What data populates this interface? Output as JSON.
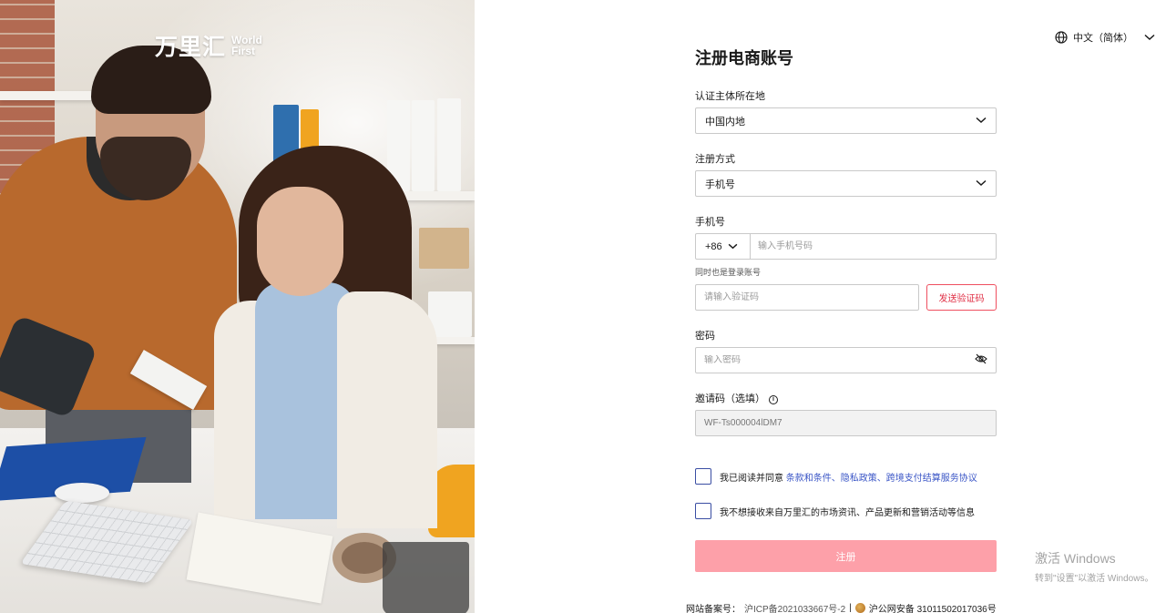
{
  "brand": {
    "name_cn": "万里汇",
    "name_en_line1": "World",
    "name_en_line2": "First"
  },
  "language": {
    "label": "中文（简体）",
    "icon": "globe-icon"
  },
  "form": {
    "title": "注册电商账号",
    "region": {
      "label": "认证主体所在地",
      "value": "中国内地"
    },
    "method": {
      "label": "注册方式",
      "value": "手机号"
    },
    "phone": {
      "label": "手机号",
      "country_code": "+86",
      "placeholder": "输入手机号码",
      "hint": "同时也是登录账号"
    },
    "verify": {
      "placeholder": "请输入验证码",
      "send_button": "发送验证码"
    },
    "password": {
      "label": "密码",
      "placeholder": "输入密码",
      "toggle_icon": "eye-off-icon"
    },
    "invite": {
      "label": "邀请码（选填）",
      "value": "WF-Ts000004lDM7"
    },
    "agreement": {
      "prefix": "我已阅读并同意 ",
      "links_text": "条款和条件、隐私政策、跨境支付结算服务协议"
    },
    "marketing_optout": {
      "text": "我不想接收来自万里汇的市场资讯、产品更新和营销活动等信息"
    },
    "submit_label": "注册"
  },
  "footer": {
    "icp_label": "网站备案号：",
    "icp_value": "沪ICP备2021033667号-2",
    "separator": "|",
    "police_value": "沪公网安备 31011502017036号"
  },
  "watermark": {
    "line1": "激活 Windows",
    "line2": "转到\"设置\"以激活 Windows。"
  },
  "colors": {
    "accent": "#e02f45",
    "submit_disabled": "#fda0a9",
    "link": "#3a55c6",
    "checkbox_border": "#3a4ea3"
  }
}
